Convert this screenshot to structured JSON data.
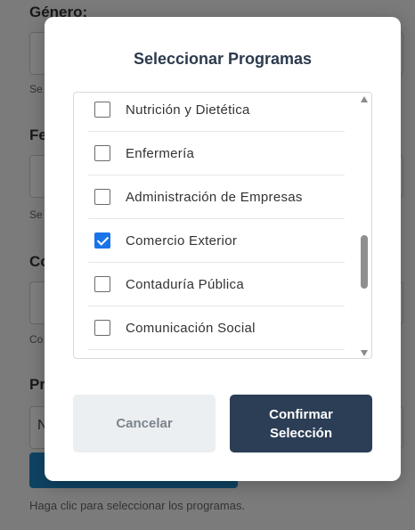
{
  "background_form": {
    "genero_label": "Género:",
    "field2_label": "Fe",
    "field3_label": "Co",
    "field4_label": "Pr",
    "hint_prefix": "Se",
    "hint3_prefix": "Co",
    "field4_value_prefix": "N",
    "bottom_hint": "Haga clic para seleccionar los programas."
  },
  "modal": {
    "title": "Seleccionar Programas",
    "items": [
      {
        "label": "Nutrición y Dietética",
        "checked": false
      },
      {
        "label": "Enfermería",
        "checked": false
      },
      {
        "label": "Administración de Empresas",
        "checked": false
      },
      {
        "label": "Comercio Exterior",
        "checked": true
      },
      {
        "label": "Contaduría Pública",
        "checked": false
      },
      {
        "label": "Comunicación Social",
        "checked": false
      }
    ],
    "cancel_label": "Cancelar",
    "confirm_label": "Confirmar Selección"
  },
  "colors": {
    "confirm_bg": "#2c3e55",
    "checkbox_checked": "#1a73e8",
    "cancel_bg": "#eceff1"
  }
}
